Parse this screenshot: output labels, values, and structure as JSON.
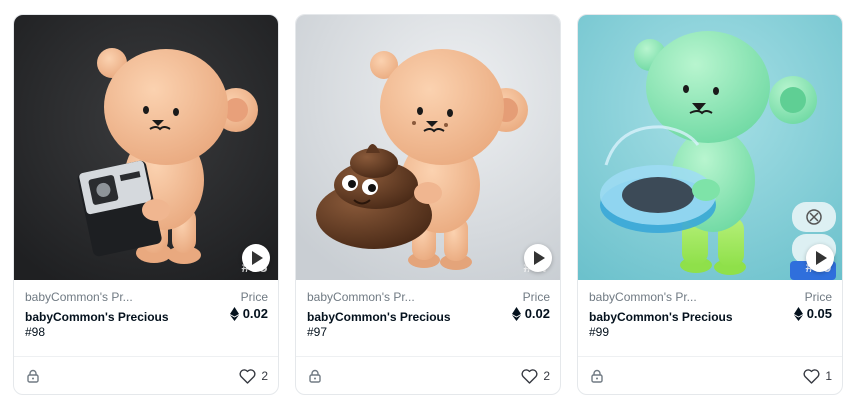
{
  "cards": [
    {
      "collection": "babyCommon's Pr...",
      "title_line1": "babyCommon's Precious",
      "title_line2": "#98",
      "price_label": "Price",
      "price": "0.02",
      "likes": "2",
      "overlay_tag": "#98",
      "image_desc": "peach bear figure holding silver box",
      "bg_color": "#2a2b2d"
    },
    {
      "collection": "babyCommon's Pr...",
      "title_line1": "babyCommon's Precious",
      "title_line2": "#97",
      "price_label": "Price",
      "price": "0.02",
      "likes": "2",
      "overlay_tag": "#97",
      "image_desc": "peach bear figure holding poop emoji",
      "bg_color": "#d9dde1"
    },
    {
      "collection": "babyCommon's Pr...",
      "title_line1": "babyCommon's Precious",
      "title_line2": "#99",
      "price_label": "Price",
      "price": "0.05",
      "likes": "1",
      "overlay_tag": "#99",
      "image_desc": "mint green bear figure holding blue bowl",
      "bg_color": "#8fd4dc"
    }
  ],
  "icons": {
    "currency": "ethereum-icon",
    "lock": "lock-icon",
    "favorite": "heart-icon",
    "video": "play-icon"
  }
}
